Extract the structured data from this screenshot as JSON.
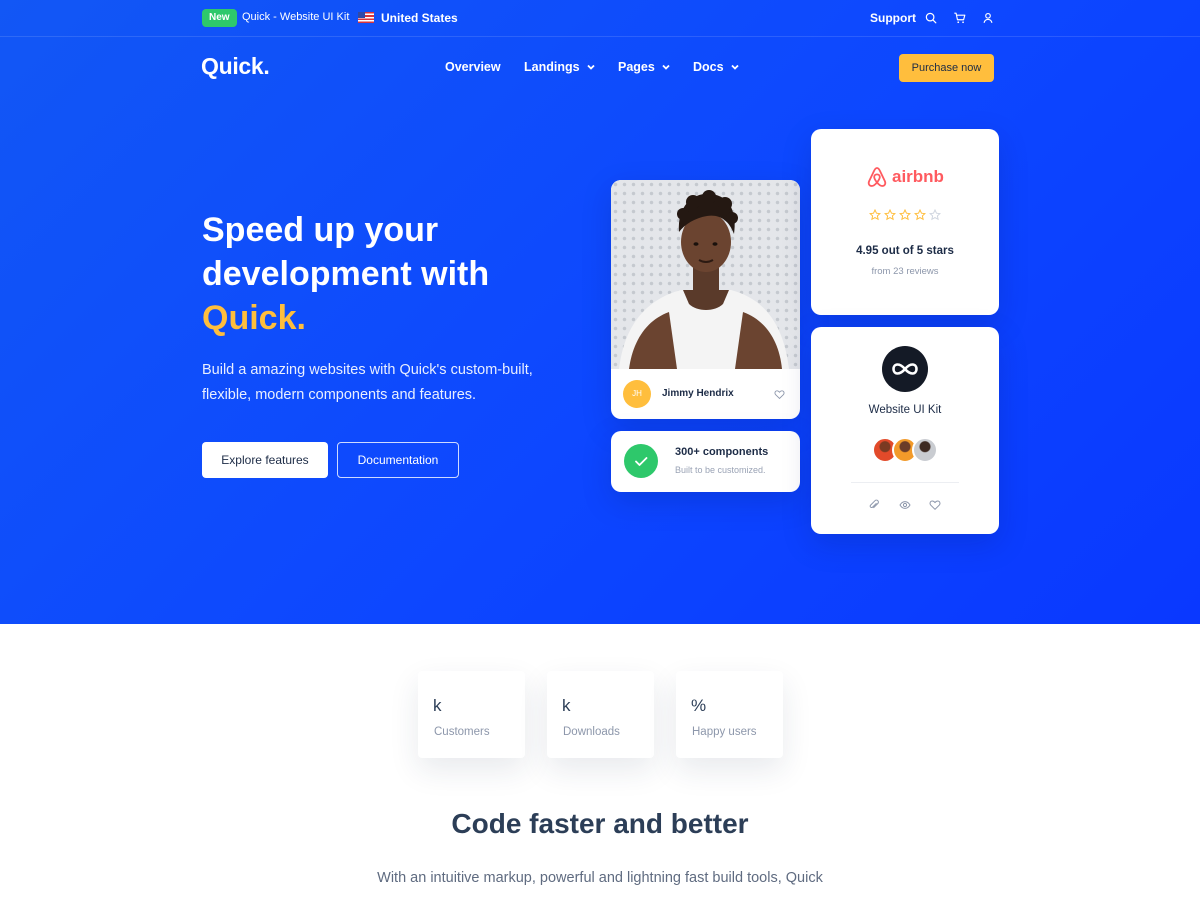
{
  "topbar": {
    "badge": "New",
    "kit_link": "Quick - Website UI Kit",
    "country": "United States",
    "support": "Support",
    "icons": [
      "search-icon",
      "cart-icon",
      "user-icon"
    ]
  },
  "nav": {
    "logo": "Quick.",
    "items": [
      {
        "label": "Overview",
        "dropdown": false
      },
      {
        "label": "Landings",
        "dropdown": true
      },
      {
        "label": "Pages",
        "dropdown": true
      },
      {
        "label": "Docs",
        "dropdown": true
      }
    ],
    "purchase": "Purchase now"
  },
  "hero": {
    "title_line1": "Speed up your",
    "title_line2": "development with",
    "title_highlight": "Quick.",
    "lead": "Build a amazing websites with Quick's custom-built, flexible, modern components and features.",
    "primary_button": "Explore features",
    "secondary_button": "Documentation"
  },
  "cards": {
    "profile": {
      "initials": "JH",
      "name": "Jimmy Hendrix"
    },
    "components": {
      "title": "300+ components",
      "subtitle": "Built to be customized."
    },
    "airbnb": {
      "brand": "airbnb",
      "stars_filled": 4,
      "stars_total": 5,
      "rating": "4.95 out of 5 stars",
      "reviews": "from 23 reviews"
    },
    "kit": {
      "name": "Website UI Kit"
    }
  },
  "stats": [
    {
      "value": "k",
      "label": "Customers"
    },
    {
      "value": "k",
      "label": "Downloads"
    },
    {
      "value": "%",
      "label": "Happy users"
    }
  ],
  "section": {
    "title": "Code faster and better",
    "subtitle": "With an intuitive markup, powerful and lightning fast build tools, Quick"
  },
  "colors": {
    "hero_blue": "#0d47ff",
    "accent_yellow": "#ffbe3d",
    "success_green": "#2ec86b",
    "airbnb_red": "#ff5a5f"
  }
}
